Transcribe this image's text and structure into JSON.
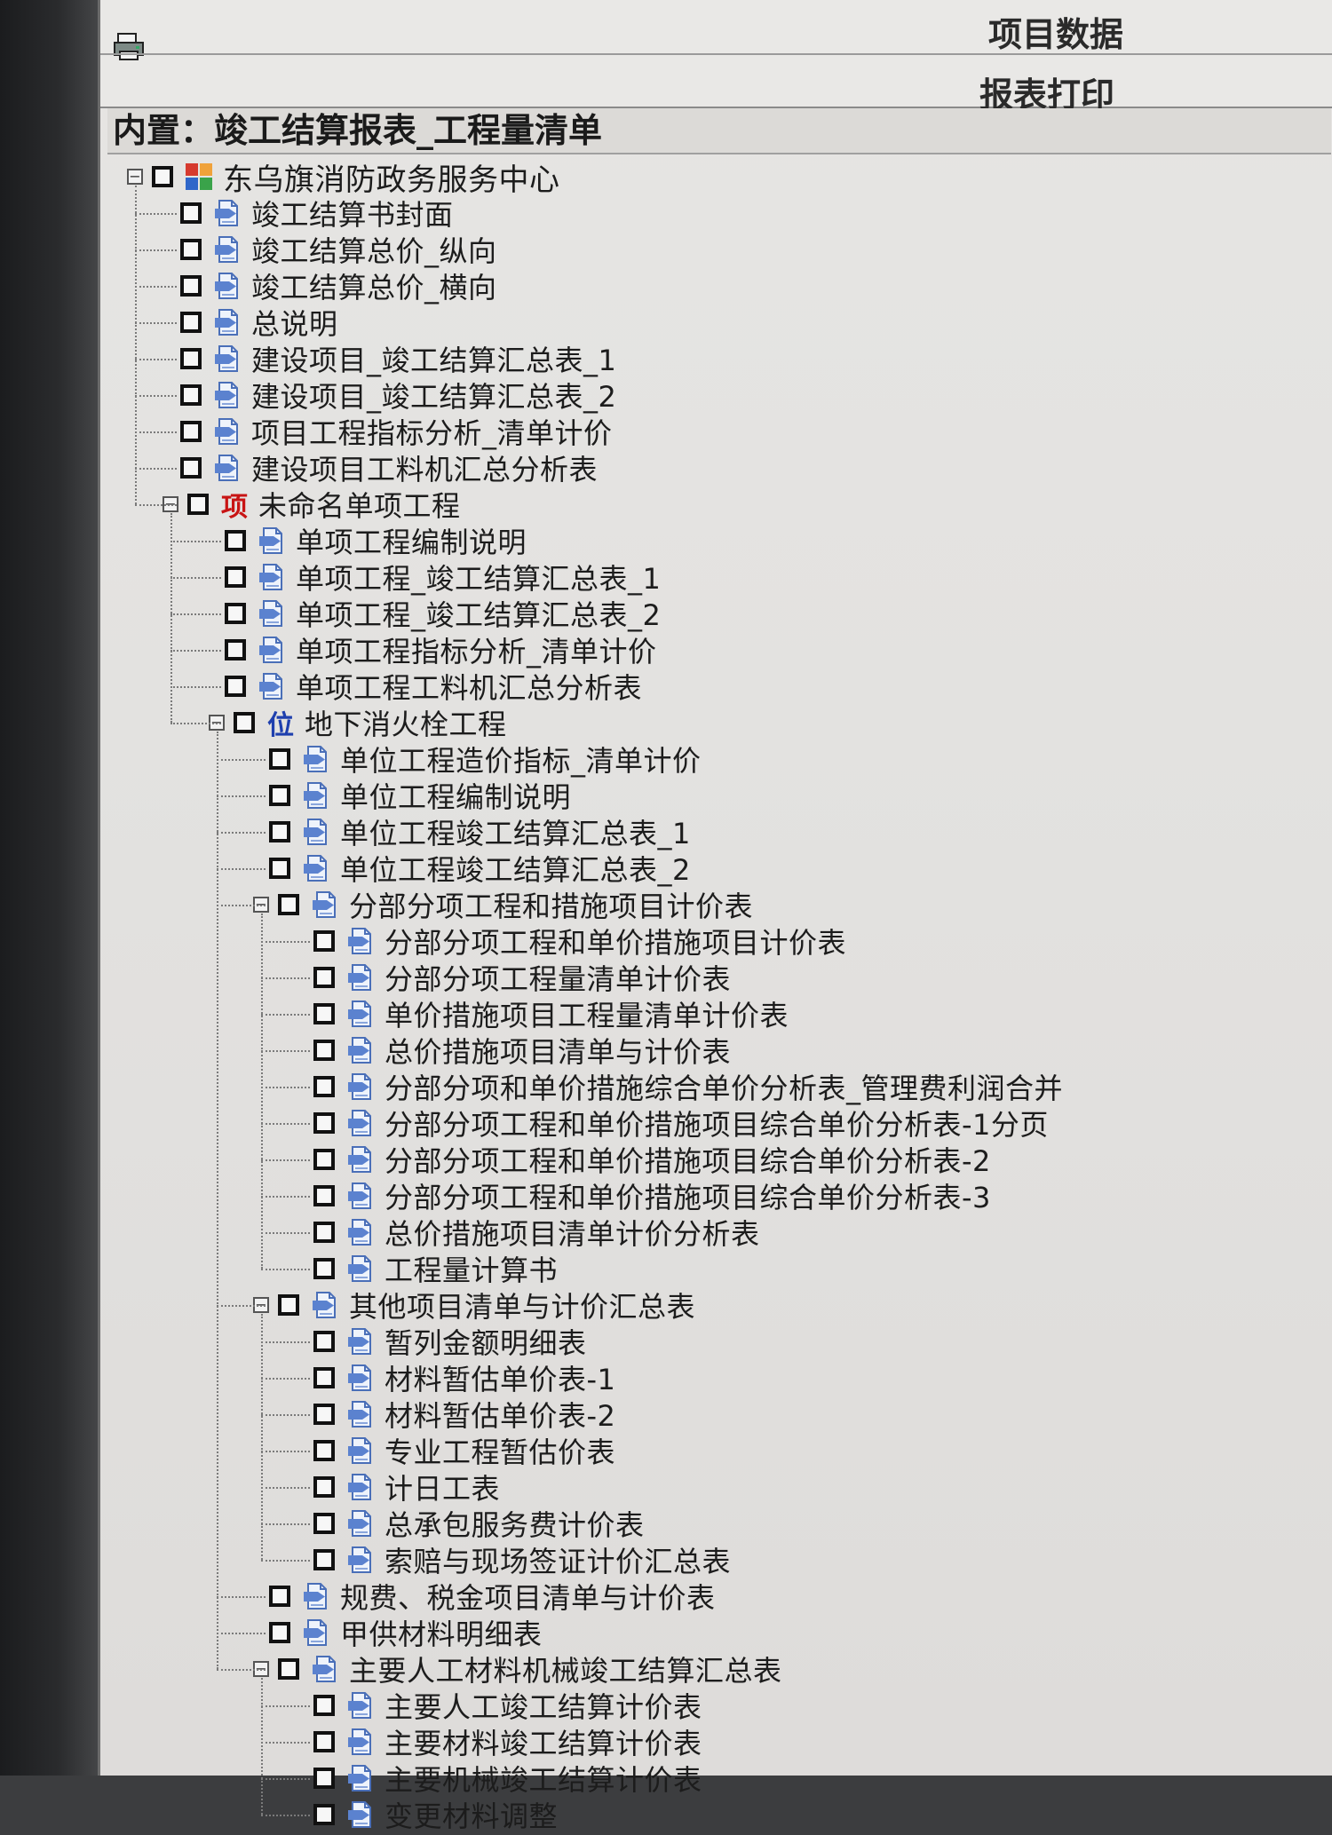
{
  "header": {
    "print_icon": "printer-icon",
    "project_data_label": "项目数据",
    "report_print_label": "报表打印",
    "builtin_title": "内置：竣工结算报表_工程量清单"
  },
  "tree": {
    "root": {
      "label": "东乌旗消防政务服务中心",
      "icon": "project-grid-icon"
    },
    "project_reports": [
      "竣工结算书封面",
      "竣工结算总价_纵向",
      "竣工结算总价_横向",
      "总说明",
      "建设项目_竣工结算汇总表_1",
      "建设项目_竣工结算汇总表_2",
      "项目工程指标分析_清单计价",
      "建设项目工料机汇总分析表"
    ],
    "single_project": {
      "label": "未命名单项工程",
      "icon_glyph": "项"
    },
    "single_reports": [
      "单项工程编制说明",
      "单项工程_竣工结算汇总表_1",
      "单项工程_竣工结算汇总表_2",
      "单项工程指标分析_清单计价",
      "单项工程工料机汇总分析表"
    ],
    "unit_project": {
      "label": "地下消火栓工程",
      "icon_glyph": "位"
    },
    "unit_reports": [
      "单位工程造价指标_清单计价",
      "单位工程编制说明",
      "单位工程竣工结算汇总表_1",
      "单位工程竣工结算汇总表_2"
    ],
    "group1": {
      "label": "分部分项工程和措施项目计价表",
      "items": [
        "分部分项工程和单价措施项目计价表",
        "分部分项工程量清单计价表",
        "单价措施项目工程量清单计价表",
        "总价措施项目清单与计价表",
        "分部分项和单价措施综合单价分析表_管理费利润合并",
        "分部分项工程和单价措施项目综合单价分析表-1分页",
        "分部分项工程和单价措施项目综合单价分析表-2",
        "分部分项工程和单价措施项目综合单价分析表-3",
        "总价措施项目清单计价分析表",
        "工程量计算书"
      ]
    },
    "group2": {
      "label": "其他项目清单与计价汇总表",
      "items": [
        "暂列金额明细表",
        "材料暂估单价表-1",
        "材料暂估单价表-2",
        "专业工程暂估价表",
        "计日工表",
        "总承包服务费计价表",
        "索赔与现场签证计价汇总表"
      ]
    },
    "unit_reports_after": [
      "规费、税金项目清单与计价表",
      "甲供材料明细表"
    ],
    "group3": {
      "label": "主要人工材料机械竣工结算汇总表",
      "items": [
        "主要人工竣工结算计价表",
        "主要材料竣工结算计价表",
        "主要机械竣工结算计价表",
        "变更材料调整"
      ]
    }
  }
}
